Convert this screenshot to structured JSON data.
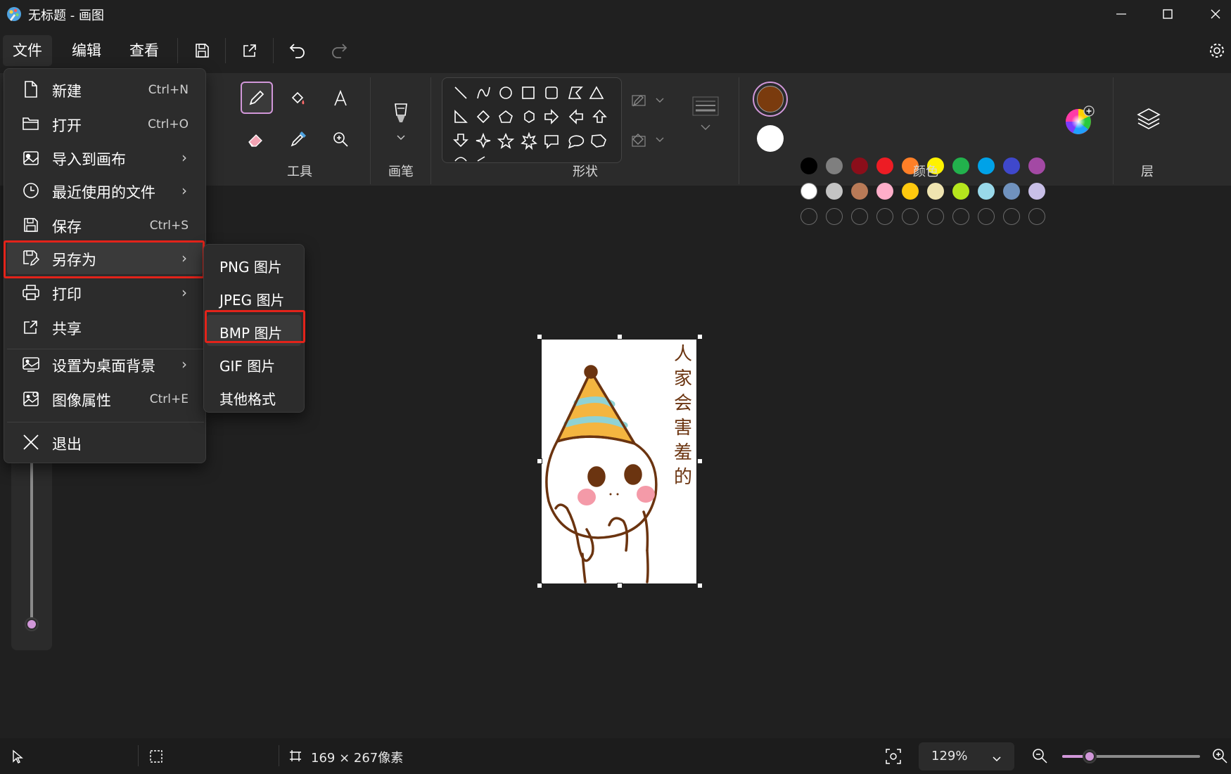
{
  "window": {
    "title": "无标题 - 画图"
  },
  "menubar": {
    "file": "文件",
    "edit": "编辑",
    "view": "查看"
  },
  "ribbon": {
    "groups": {
      "tools": "工具",
      "brushes": "画笔",
      "shapes": "形状",
      "colors": "颜色",
      "layers": "层"
    },
    "selected_tool": "pencil-tool",
    "primary_color": "#7a3b0e",
    "secondary_color": "#ffffff",
    "palette_row1": [
      "#000000",
      "#7f7f7f",
      "#8b0e1a",
      "#ed1c24",
      "#ff7f27",
      "#fff200",
      "#22b14c",
      "#00a2e8",
      "#3f48cc",
      "#a349a4"
    ],
    "palette_row2": [
      "#ffffff",
      "#c3c3c3",
      "#b97a57",
      "#ffaec9",
      "#ffc90e",
      "#efe4b0",
      "#b5e61d",
      "#99d9ea",
      "#7092be",
      "#c8bfe7"
    ]
  },
  "file_menu": {
    "items": [
      {
        "label": "新建",
        "shortcut": "Ctrl+N",
        "icon": "new-file-icon"
      },
      {
        "label": "打开",
        "shortcut": "Ctrl+O",
        "icon": "folder-open-icon"
      },
      {
        "label": "导入到画布",
        "submenu": true,
        "icon": "import-image-icon"
      },
      {
        "label": "最近使用的文件",
        "submenu": true,
        "icon": "clock-icon"
      },
      {
        "label": "保存",
        "shortcut": "Ctrl+S",
        "icon": "save-icon"
      },
      {
        "label": "另存为",
        "submenu": true,
        "highlighted": true,
        "icon": "save-as-icon"
      },
      {
        "label": "打印",
        "submenu": true,
        "icon": "print-icon"
      },
      {
        "label": "共享",
        "icon": "share-icon"
      },
      {
        "label": "设置为桌面背景",
        "submenu": true,
        "icon": "wallpaper-icon"
      },
      {
        "label": "图像属性",
        "shortcut": "Ctrl+E",
        "icon": "image-properties-icon"
      },
      {
        "label": "退出",
        "icon": "close-icon"
      }
    ]
  },
  "save_as_menu": {
    "items": [
      {
        "label": "PNG 图片"
      },
      {
        "label": "JPEG 图片"
      },
      {
        "label": "BMP 图片",
        "highlighted": true
      },
      {
        "label": "GIF 图片"
      },
      {
        "label": "其他格式"
      }
    ]
  },
  "canvas": {
    "artwork_text": [
      "人",
      "家",
      "会",
      "害",
      "羞",
      "的"
    ]
  },
  "statusbar": {
    "canvas_size": "169 × 267像素",
    "zoom": "129%",
    "zoom_slider_fraction": 0.2
  }
}
